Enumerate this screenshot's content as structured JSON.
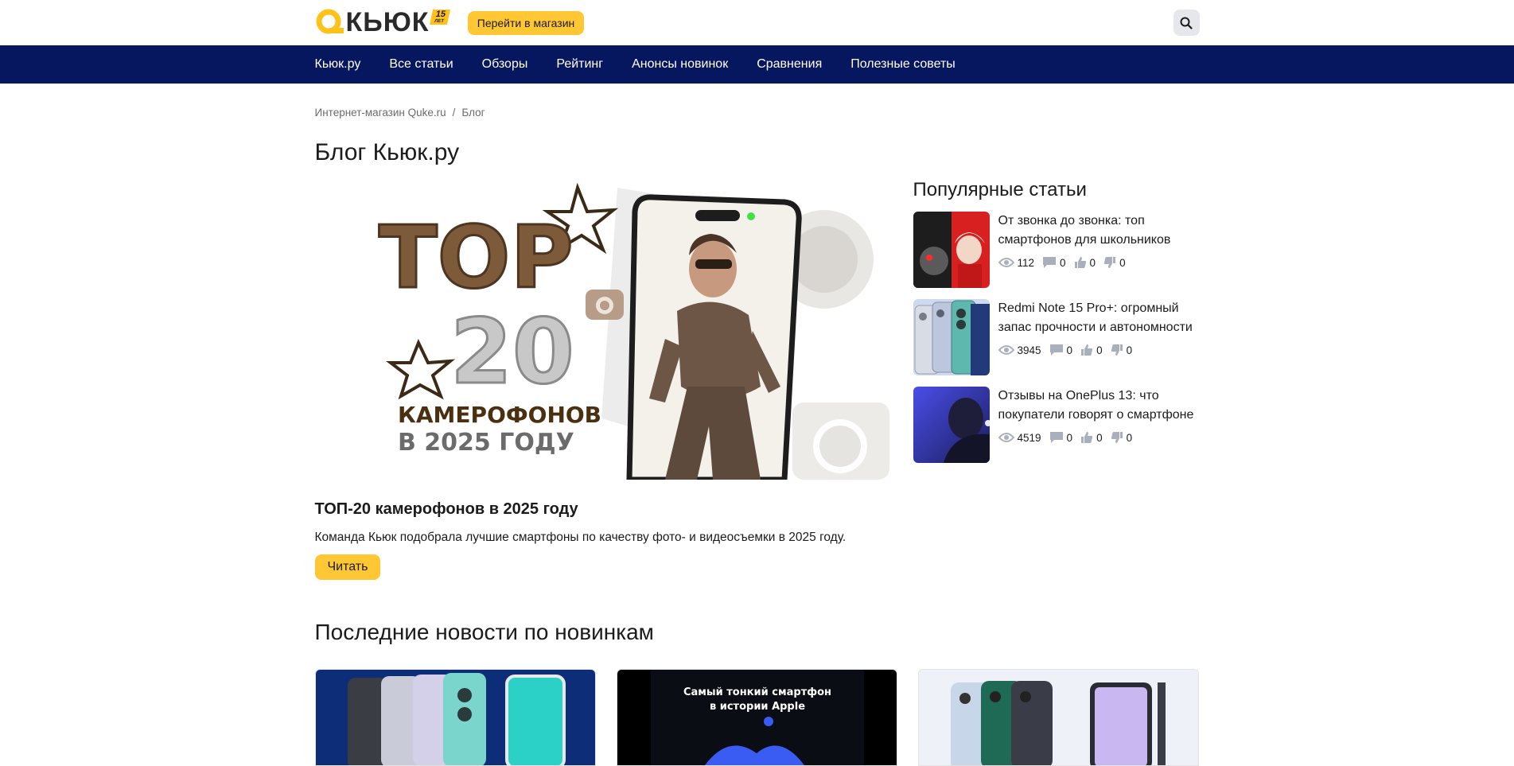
{
  "header": {
    "logo_text": "КЬЮК",
    "logo_badge_num": "15",
    "logo_badge_sub": "ЛЕТ",
    "shop_button": "Перейти в магазин",
    "search_label": "Поиск"
  },
  "nav": {
    "items": [
      {
        "label": "Кьюк.ру"
      },
      {
        "label": "Все статьи"
      },
      {
        "label": "Обзоры"
      },
      {
        "label": "Рейтинг"
      },
      {
        "label": "Анонсы новинок"
      },
      {
        "label": "Сравнения"
      },
      {
        "label": "Полезные советы"
      }
    ]
  },
  "breadcrumb": {
    "home": "Интернет-магазин Quke.ru",
    "separator": "/",
    "current": "Блог"
  },
  "page_title": "Блог Кьюк.ру",
  "featured": {
    "image_text": {
      "top": "TOP",
      "num": "20",
      "line1": "КАМЕРОФОНОВ",
      "line2": "В 2025 ГОДУ"
    },
    "title": "ТОП-20 камерофонов в 2025 году",
    "description": "Команда Кьюк подобрала лучшие смартфоны по качеству фото- и видеосъемки в 2025 году.",
    "read_button": "Читать"
  },
  "popular": {
    "title": "Популярные статьи",
    "items": [
      {
        "title": "От звонка до звонка: топ смартфонов для школьников",
        "views": "112",
        "comments": "0",
        "likes": "0",
        "dislikes": "0"
      },
      {
        "title": "Redmi Note 15 Pro+: огромный запас прочности и автономности",
        "views": "3945",
        "comments": "0",
        "likes": "0",
        "dislikes": "0"
      },
      {
        "title": "Отзывы на OnePlus 13: что покупатели говорят о смартфоне",
        "views": "4519",
        "comments": "0",
        "likes": "0",
        "dislikes": "0"
      }
    ]
  },
  "latest": {
    "title": "Последние новости по новинкам",
    "card2_text": "Самый тонкий смартфон\nв истории Apple"
  },
  "colors": {
    "accent": "#ffc733",
    "nav_bg": "#07175f",
    "stat_icon": "#a9afbd"
  }
}
